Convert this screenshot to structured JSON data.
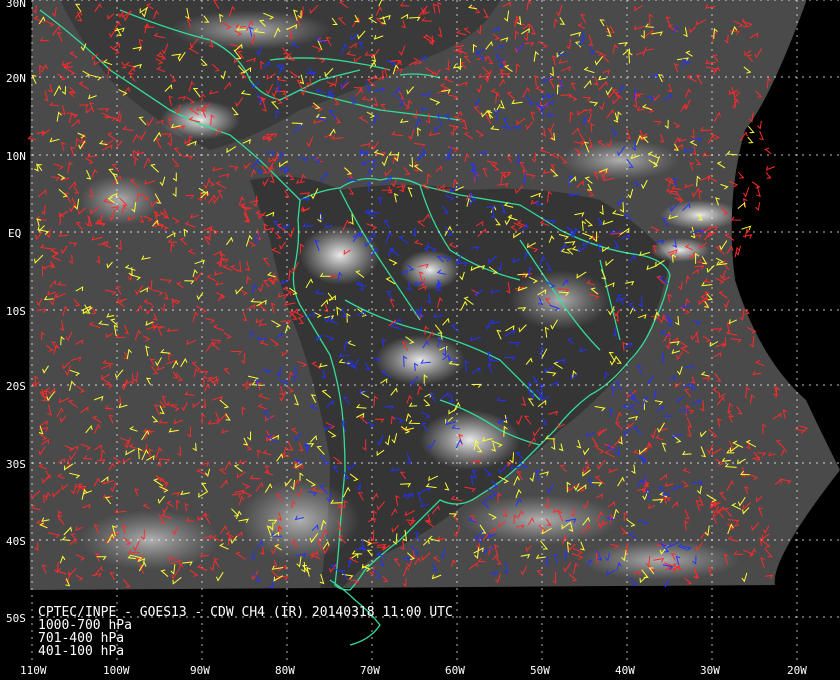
{
  "caption": {
    "title": "CPTEC/INPE - GOES13 - CDW CH4 (IR) 20140318 11:00 UTC",
    "legend": [
      {
        "label": "1000-700 hPa",
        "color": "#ff2a2a"
      },
      {
        "label": "701-400 hPa",
        "color": "#ffff33"
      },
      {
        "label": "401-100 hPa",
        "color": "#2233ff"
      }
    ]
  },
  "axes": {
    "lat_labels": [
      "30N",
      "20N",
      "10N",
      "EQ",
      "10S",
      "20S",
      "30S",
      "40S",
      "50S"
    ],
    "lon_labels": [
      "110W",
      "100W",
      "90W",
      "80W",
      "70W",
      "60W",
      "50W",
      "40W",
      "30W",
      "20W"
    ]
  },
  "colors": {
    "coastline": "#33dd99",
    "grid": "#ffffff",
    "background": "#000000"
  }
}
